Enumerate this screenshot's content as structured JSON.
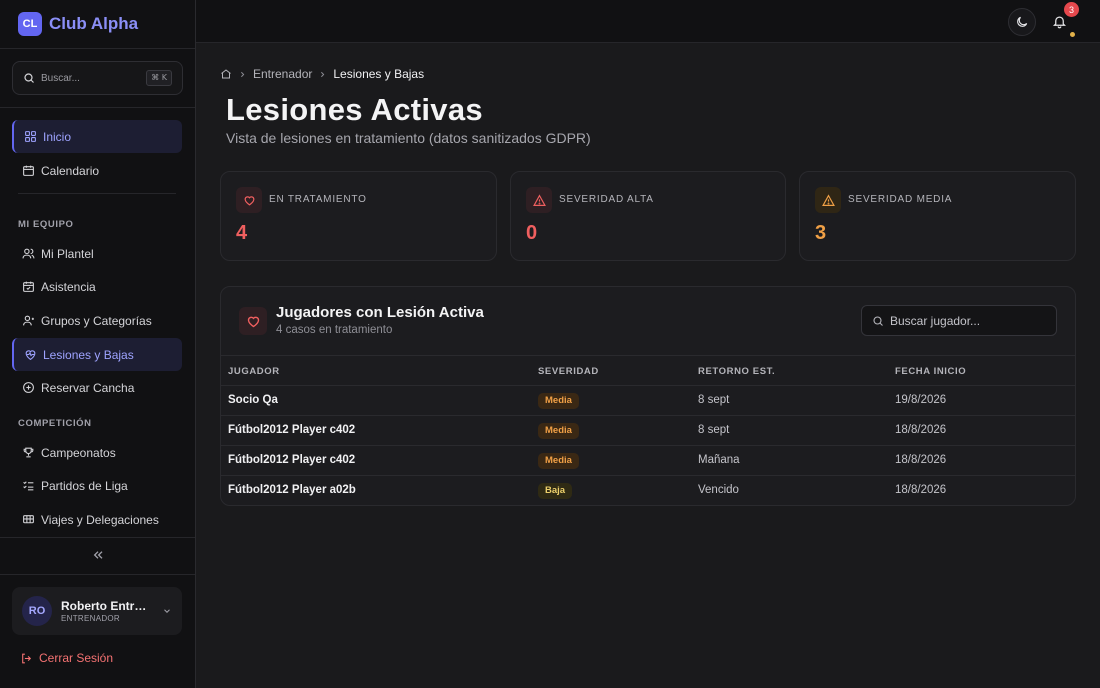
{
  "brand": {
    "logo": "CL",
    "name": "Club Alpha"
  },
  "sidebar": {
    "search_placeholder": "Buscar...",
    "search_shortcut": "⌘ K",
    "items_top": [
      {
        "label": "Inicio",
        "icon": "dashboard-icon"
      },
      {
        "label": "Calendario",
        "icon": "calendar-icon"
      }
    ],
    "section_team": "MI EQUIPO",
    "items_team": [
      {
        "label": "Mi Plantel",
        "icon": "users-icon"
      },
      {
        "label": "Asistencia",
        "icon": "calendar-check-icon"
      },
      {
        "label": "Grupos y Categorías",
        "icon": "user-group-icon"
      },
      {
        "label": "Lesiones y Bajas",
        "icon": "heart-pulse-icon"
      },
      {
        "label": "Reservar Cancha",
        "icon": "plus-circle-icon"
      }
    ],
    "section_comp": "COMPETICIÓN",
    "items_comp": [
      {
        "label": "Campeonatos",
        "icon": "trophy-icon"
      },
      {
        "label": "Partidos de Liga",
        "icon": "list-check-icon"
      },
      {
        "label": "Viajes y Delegaciones",
        "icon": "bus-icon"
      }
    ],
    "user": {
      "initials": "RO",
      "name": "Roberto Entrenador",
      "role": "ENTRENADOR"
    },
    "logout": "Cerrar Sesión"
  },
  "topbar": {
    "notifications_count": "3"
  },
  "breadcrumb": {
    "parent": "Entrenador",
    "current": "Lesiones y Bajas"
  },
  "page": {
    "title": "Lesiones Activas",
    "subtitle": "Vista de lesiones en tratamiento (datos sanitizados GDPR)"
  },
  "stats": [
    {
      "label": "EN TRATAMIENTO",
      "value": "4",
      "color": "#ef5f5f"
    },
    {
      "label": "SEVERIDAD ALTA",
      "value": "0",
      "color": "#ef5f5f"
    },
    {
      "label": "SEVERIDAD MEDIA",
      "value": "3",
      "color": "#f0a046"
    }
  ],
  "table": {
    "title": "Jugadores con Lesión Activa",
    "subtitle": "4 casos en tratamiento",
    "search_placeholder": "Buscar jugador...",
    "headers": [
      "JUGADOR",
      "SEVERIDAD",
      "RETORNO EST.",
      "FECHA INICIO"
    ],
    "rows": [
      {
        "player": "Socio Qa",
        "severity": "Media",
        "return": "8 sept",
        "start": "19/8/2026"
      },
      {
        "player": "Fútbol2012 Player c402",
        "severity": "Media",
        "return": "8 sept",
        "start": "18/8/2026"
      },
      {
        "player": "Fútbol2012 Player c402",
        "severity": "Media",
        "return": "Mañana",
        "start": "18/8/2026"
      },
      {
        "player": "Fútbol2012 Player a02b",
        "severity": "Baja",
        "return": "Vencido",
        "start": "18/8/2026"
      }
    ]
  }
}
